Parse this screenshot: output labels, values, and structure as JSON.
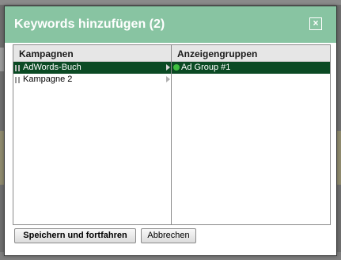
{
  "dialog": {
    "title": "Keywords hinzufügen (2)",
    "close_label": "×"
  },
  "campaigns": {
    "header": "Kampagnen",
    "items": [
      {
        "label": "AdWords-Buch",
        "selected": true,
        "icon": "pause-icon"
      },
      {
        "label": "Kampagne 2",
        "selected": false,
        "icon": "pause-icon"
      }
    ]
  },
  "adgroups": {
    "header": "Anzeigengruppen",
    "items": [
      {
        "label": "Ad Group #1",
        "selected": true,
        "icon": "active-dot-icon"
      }
    ]
  },
  "buttons": {
    "save_label": "Speichern und fortfahren",
    "cancel_label": "Abbrechen"
  },
  "colors": {
    "titlebar": "#88c4a2",
    "selection": "#0b4a24",
    "active_dot": "#3fbf3f"
  }
}
